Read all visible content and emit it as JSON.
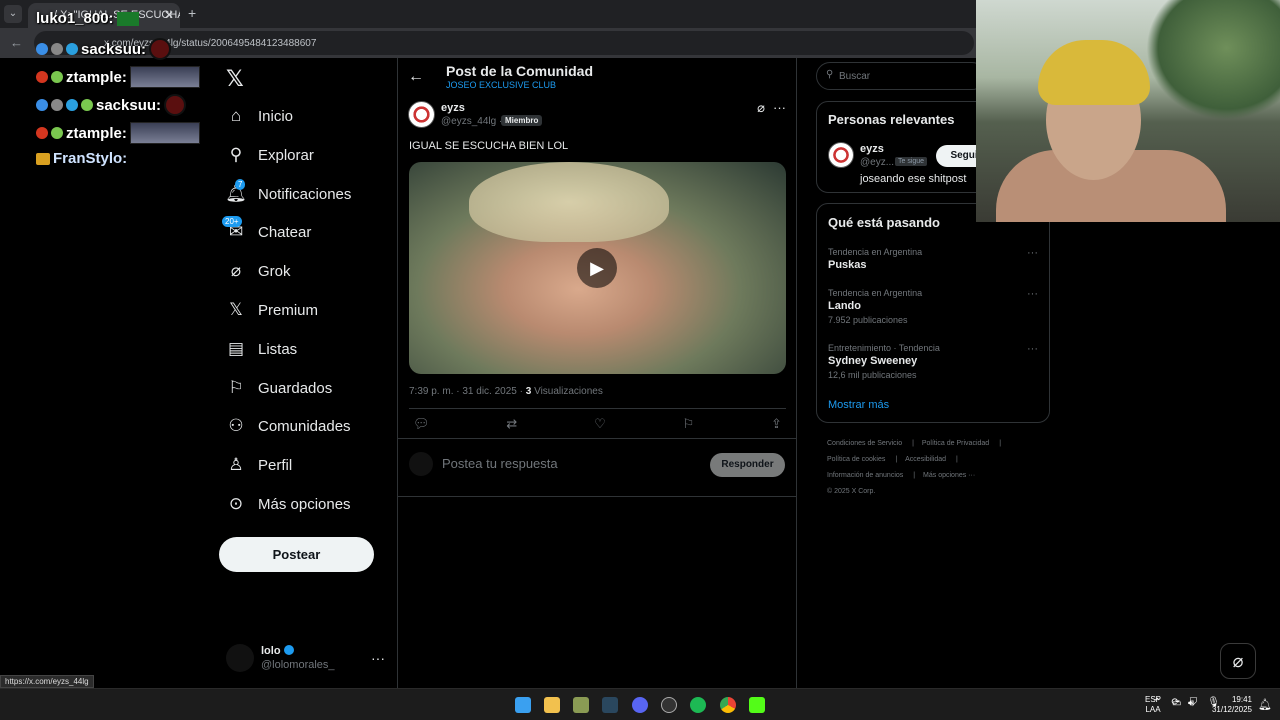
{
  "browser": {
    "tab_title": "/ X: \"IGUAL SE ESCUCHA BI... EXCLUSIVE",
    "url": "x.com/eyzs_44lg/status/2006495484123488607",
    "status_url": "https://x.com/eyzs_44lg"
  },
  "chat": [
    {
      "user": "luko1_800:",
      "color": "#ffffff"
    },
    {
      "user": "sacksuu:",
      "color": "#ffffff"
    },
    {
      "user": "ztample:",
      "color": "#ffffff"
    },
    {
      "user": "sacksuu:",
      "color": "#ffffff"
    },
    {
      "user": "ztample:",
      "color": "#ffffff"
    },
    {
      "user": "FranStylo:",
      "color": "#ffffff"
    }
  ],
  "nav": {
    "logo": "𝕏",
    "items": [
      {
        "label": "Inicio",
        "icon": "home-icon"
      },
      {
        "label": "Explorar",
        "icon": "search-icon"
      },
      {
        "label": "Notificaciones",
        "icon": "bell-icon",
        "badge": "7"
      },
      {
        "label": "Chatear",
        "icon": "mail-icon",
        "badge": "20+"
      },
      {
        "label": "Grok",
        "icon": "grok-icon"
      },
      {
        "label": "Premium",
        "icon": "x-icon"
      },
      {
        "label": "Listas",
        "icon": "list-icon"
      },
      {
        "label": "Guardados",
        "icon": "bookmark-icon"
      },
      {
        "label": "Comunidades",
        "icon": "communities-icon"
      },
      {
        "label": "Perfil",
        "icon": "person-icon"
      },
      {
        "label": "Más opciones",
        "icon": "more-circle-icon"
      }
    ],
    "post_button": "Postear"
  },
  "account": {
    "name": "lolo",
    "handle": "@lolomorales_"
  },
  "header": {
    "title": "Post de la Comunidad",
    "subtitle": "JOSEO EXCLUSIVE CLUB"
  },
  "post": {
    "author_name": "eyzs",
    "author_handle": "@eyzs_44lg ·",
    "member_badge": "Miembro",
    "text": "IGUAL SE ESCUCHA BIEN LOL",
    "time": "7:39 p. m. · 31 dic. 2025 ·",
    "views_count": "3",
    "views_label": "Visualizaciones"
  },
  "reply": {
    "placeholder": "Postea tu respuesta",
    "button": "Responder"
  },
  "search": {
    "placeholder": "Buscar"
  },
  "relevant": {
    "title": "Personas relevantes",
    "name": "eyzs",
    "handle": "@eyz...",
    "follows_you": "Te sigue",
    "follow_button": "Seguir",
    "bio": "joseando ese shitpost"
  },
  "trending": {
    "title": "Qué está pasando",
    "items": [
      {
        "context": "Tendencia en Argentina",
        "topic": "Puskas",
        "count": ""
      },
      {
        "context": "Tendencia en Argentina",
        "topic": "Lando",
        "count": "7.952 publicaciones"
      },
      {
        "context": "Entretenimiento · Tendencia",
        "topic": "Sydney Sweeney",
        "count": "12,6 mil publicaciones"
      }
    ],
    "show_more": "Mostrar más"
  },
  "footer": {
    "links": [
      "Condiciones de Servicio",
      "Política de Privacidad",
      "Política de cookies",
      "Accesibilidad",
      "Información de anuncios",
      "Más opciones ···"
    ],
    "copyright": "© 2025 X Corp."
  },
  "taskbar": {
    "lang_top": "ESP",
    "lang_bottom": "LAA",
    "time": "19:41",
    "date": "31/12/2025"
  }
}
